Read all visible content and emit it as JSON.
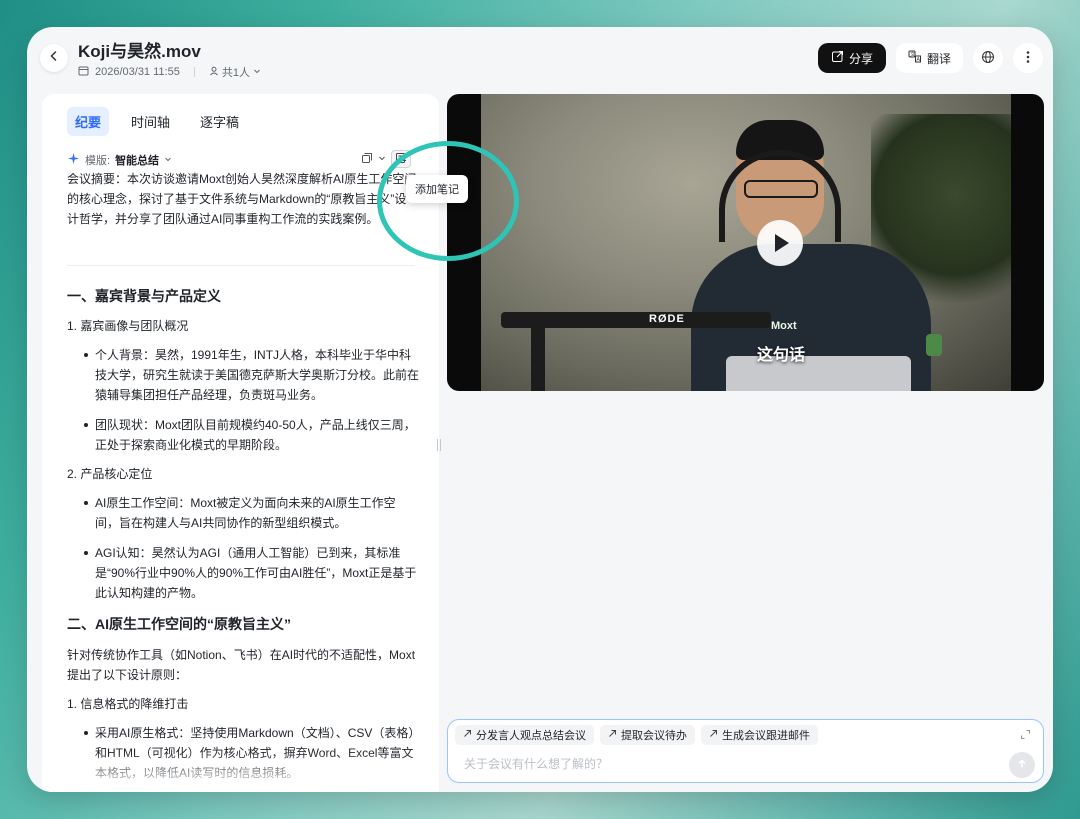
{
  "header": {
    "title": "Koji与昊然.mov",
    "datetime": "2026/03/31 11:55",
    "participants": "共1人",
    "share_label": "分享",
    "translate_label": "翻译"
  },
  "tabs": [
    {
      "label": "纪要"
    },
    {
      "label": "时间轴"
    },
    {
      "label": "逐字稿"
    }
  ],
  "template": {
    "label": "模版:",
    "value": "智能总结"
  },
  "tooltip": "添加笔记",
  "summary": "会议摘要：本次访谈邀请Moxt创始人昊然深度解析AI原生工作空间的核心理念，探讨了基于文件系统与Markdown的“原教旨主义”设计哲学，并分享了团队通过AI同事重构工作流的实践案例。",
  "sections": {
    "s1_title": "一、嘉宾背景与产品定义",
    "s1_1": "1. 嘉宾画像与团队概况",
    "b1": "个人背景：昊然，1991年生，INTJ人格，本科毕业于华中科技大学，研究生就读于美国德克萨斯大学奥斯汀分校。此前在猿辅导集团担任产品经理，负责斑马业务。",
    "b2": "团队现状：Moxt团队目前规模约40-50人，产品上线仅三周，正处于探索商业化模式的早期阶段。",
    "s1_2": "2. 产品核心定位",
    "b3": "AI原生工作空间：Moxt被定义为面向未来的AI原生工作空间，旨在构建人与AI共同协作的新型组织模式。",
    "b4": "AGI认知：昊然认为AGI（通用人工智能）已到来，其标准是“90%行业中90%人的90%工作可由AI胜任”，Moxt正是基于此认知构建的产物。",
    "s2_title": "二、AI原生工作空间的“原教旨主义”",
    "p1": "针对传统协作工具（如Notion、飞书）在AI时代的不适配性，Moxt提出了以下设计原则：",
    "s2_1": "1. 信息格式的降维打击",
    "b5": "采用AI原生格式：坚持使用Markdown（文档）、CSV（表格）和HTML（可视化）作为核心格式，摒弃Word、Excel等富文本格式，以降低AI读写时的信息损耗。"
  },
  "video": {
    "subtitle": "这句话",
    "mic_brand": "RØDE",
    "shirt_logo": "Moxt"
  },
  "chat": {
    "chips": [
      {
        "label": "分发言人观点总结会议"
      },
      {
        "label": "提取会议待办"
      },
      {
        "label": "生成会议跟进邮件"
      }
    ],
    "placeholder": "关于会议有什么想了解的？"
  },
  "icons": {
    "back": "chevron-left-icon",
    "share": "share-icon",
    "translate": "translate-icon",
    "globe": "globe-icon",
    "more": "more-vertical-icon",
    "sparkle": "sparkle-icon",
    "copy": "copy-icon",
    "add_note": "add-note-icon",
    "play": "play-icon",
    "expand": "expand-icon",
    "send": "send-icon"
  },
  "colors": {
    "accent": "#2f6bff",
    "highlight_ring": "#2ec4b6",
    "share_bg": "#111111"
  }
}
